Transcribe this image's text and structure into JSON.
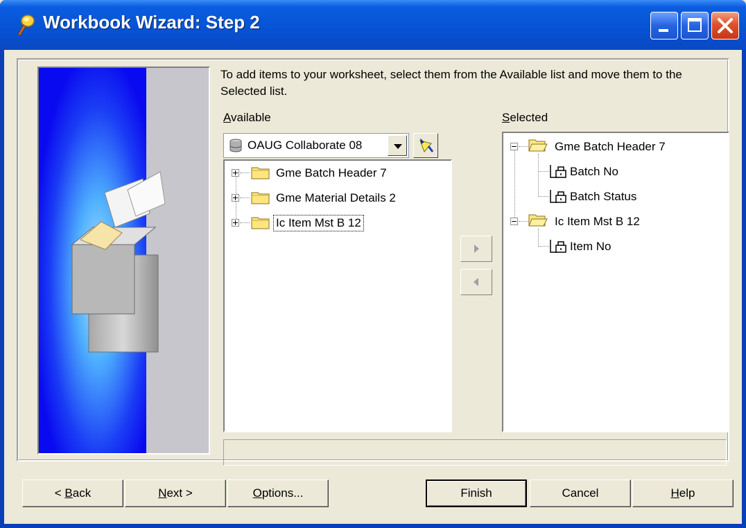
{
  "window": {
    "title": "Workbook Wizard: Step 2",
    "accent": "#0a5de0",
    "close_color": "#e0502c"
  },
  "instructions": "To add items to your worksheet, select them from the Available list and move them to the Selected list.",
  "available": {
    "label_prefix": "",
    "label_mnemonic": "A",
    "label_rest": "vailable",
    "business_area": "OAUG Collaborate 08",
    "items": [
      {
        "label": "Gme Batch Header 7",
        "expander": "plus"
      },
      {
        "label": "Gme Material Details 2",
        "expander": "plus"
      },
      {
        "label": "Ic Item Mst B 12",
        "expander": "plus",
        "focused": true
      }
    ]
  },
  "selected": {
    "label_mnemonic": "S",
    "label_rest": "elected",
    "folders": [
      {
        "label": "Gme Batch Header 7",
        "items": [
          "Batch No",
          "Batch Status"
        ]
      },
      {
        "label": "Ic Item Mst B 12",
        "items": [
          "Item No"
        ]
      }
    ]
  },
  "move_buttons": {
    "add_icon": "arrow-right-icon",
    "remove_icon": "arrow-left-icon"
  },
  "footer": {
    "back": {
      "pre": "< ",
      "mnemonic": "B",
      "post": "ack"
    },
    "next": {
      "pre": "",
      "mnemonic": "N",
      "post": "ext >"
    },
    "options": {
      "pre": "",
      "mnemonic": "O",
      "post": "ptions..."
    },
    "finish": "Finish",
    "cancel": "Cancel",
    "help": {
      "pre": "",
      "mnemonic": "H",
      "post": "elp"
    }
  }
}
